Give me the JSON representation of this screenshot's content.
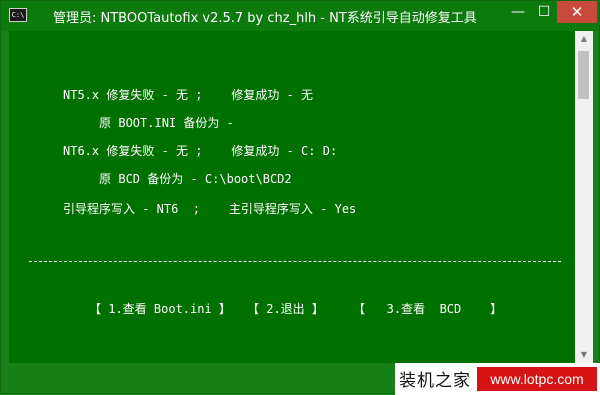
{
  "window": {
    "icon_label": "C:\\",
    "title": "管理员:  NTBOOTautofix v2.5.7 by chz_hlh - NT系统引导自动修复工具",
    "minimize_glyph": "—",
    "maximize_glyph": "☐",
    "close_glyph": "✕"
  },
  "console": {
    "lines": [
      "NT5.x 修复失败 - 无 ;    修复成功 - 无",
      "     原 BOOT.INI 备份为 -",
      "NT6.x 修复失败 - 无 ;    修复成功 - C: D:",
      "     原 BCD 备份为 - C:\\boot\\BCD2",
      "引导程序写入 - NT6  ;    主引导程序写入 - Yes"
    ],
    "menu": [
      "【 1.查看 Boot.ini 】",
      "【 2.退出 】",
      "【   3.查看  BCD    】"
    ]
  },
  "scrollbar": {
    "up_glyph": "▲",
    "down_glyph": "▼"
  },
  "watermark": {
    "site_name": "装机之家",
    "url": "www.lotpc.com"
  },
  "colors": {
    "console_bg": "#007000",
    "titlebar_bg": "#0d7a0d",
    "close_button": "#c74a3a",
    "watermark_red": "#d51313"
  }
}
